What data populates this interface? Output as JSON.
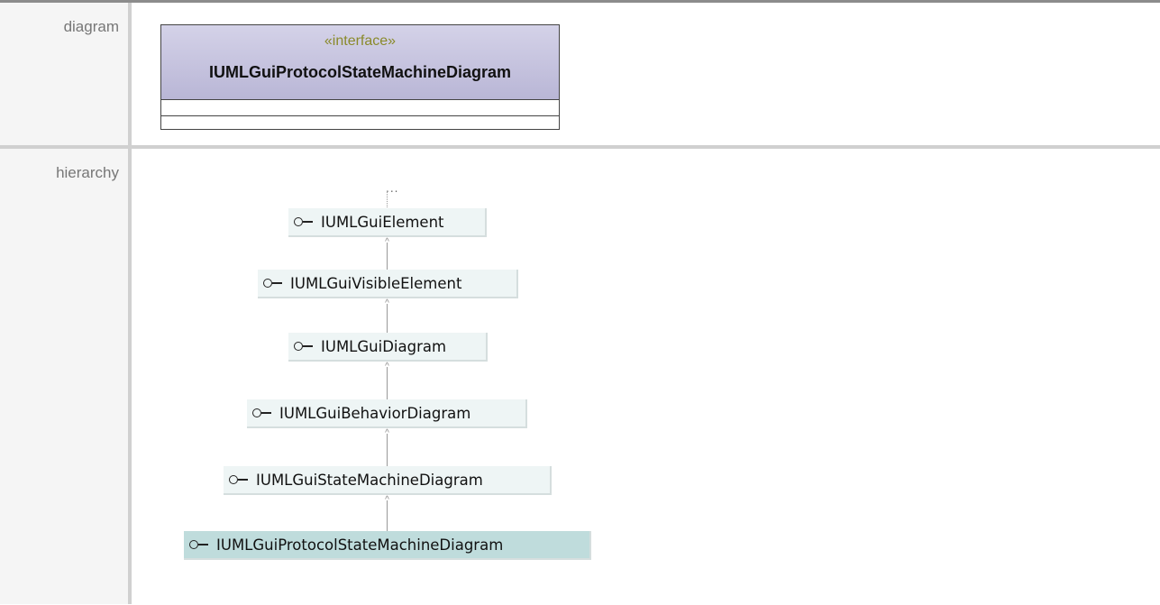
{
  "labels": {
    "diagram": "diagram",
    "hierarchy": "hierarchy"
  },
  "interface_box": {
    "stereotype": "«interface»",
    "name": "IUMLGuiProtocolStateMachineDiagram"
  },
  "hierarchy": {
    "ellipsis": "...",
    "nodes": [
      "IUMLGuiElement",
      "IUMLGuiVisibleElement",
      "IUMLGuiDiagram",
      "IUMLGuiBehaviorDiagram",
      "IUMLGuiStateMachineDiagram",
      "IUMLGuiProtocolStateMachineDiagram"
    ]
  }
}
